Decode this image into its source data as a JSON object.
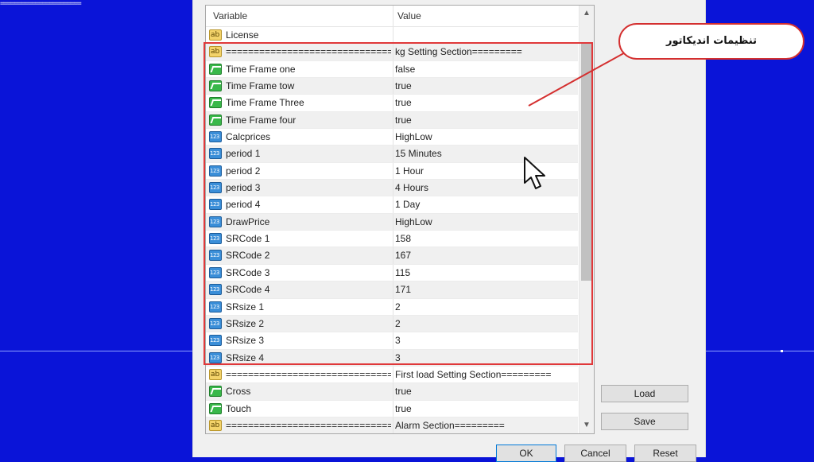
{
  "background": {
    "dashes_text": "=======================",
    "colors": {
      "desktop": "#0a14d8",
      "highlight": "#e0383a"
    }
  },
  "grid": {
    "headers": {
      "variable": "Variable",
      "value": "Value"
    },
    "rows": [
      {
        "icon": "ab-string-icon",
        "type": "ab",
        "name": "License",
        "value": ""
      },
      {
        "icon": "ab-string-icon",
        "type": "ab",
        "name": "================================",
        "value": "kg  Setting Section========="
      },
      {
        "icon": "bool-icon",
        "type": "bool",
        "name": "Time Frame one",
        "value": "false"
      },
      {
        "icon": "bool-icon",
        "type": "bool",
        "name": "Time Frame tow",
        "value": "true"
      },
      {
        "icon": "bool-icon",
        "type": "bool",
        "name": "Time Frame Three",
        "value": "true"
      },
      {
        "icon": "bool-icon",
        "type": "bool",
        "name": "Time Frame four",
        "value": "true"
      },
      {
        "icon": "number-icon",
        "type": "num",
        "name": "Calcprices",
        "value": "HighLow"
      },
      {
        "icon": "number-icon",
        "type": "num",
        "name": "period 1",
        "value": "15 Minutes"
      },
      {
        "icon": "number-icon",
        "type": "num",
        "name": "period 2",
        "value": "1 Hour"
      },
      {
        "icon": "number-icon",
        "type": "num",
        "name": "period 3",
        "value": "4 Hours"
      },
      {
        "icon": "number-icon",
        "type": "num",
        "name": "period 4",
        "value": "1 Day"
      },
      {
        "icon": "number-icon",
        "type": "num",
        "name": "DrawPrice",
        "value": "HighLow"
      },
      {
        "icon": "number-icon",
        "type": "num",
        "name": "SRCode 1",
        "value": "158"
      },
      {
        "icon": "number-icon",
        "type": "num",
        "name": "SRCode 2",
        "value": "167"
      },
      {
        "icon": "number-icon",
        "type": "num",
        "name": "SRCode 3",
        "value": "115"
      },
      {
        "icon": "number-icon",
        "type": "num",
        "name": "SRCode 4",
        "value": "171"
      },
      {
        "icon": "number-icon",
        "type": "num",
        "name": "SRsize 1",
        "value": "2"
      },
      {
        "icon": "number-icon",
        "type": "num",
        "name": "SRsize 2",
        "value": "2"
      },
      {
        "icon": "number-icon",
        "type": "num",
        "name": "SRsize 3",
        "value": "3"
      },
      {
        "icon": "number-icon",
        "type": "num",
        "name": "SRsize 4",
        "value": "3"
      },
      {
        "icon": "ab-string-icon",
        "type": "ab",
        "name": "================================",
        "value": "First load Setting Section========="
      },
      {
        "icon": "bool-icon",
        "type": "bool",
        "name": "Cross",
        "value": "true"
      },
      {
        "icon": "bool-icon",
        "type": "bool",
        "name": "Touch",
        "value": "true"
      },
      {
        "icon": "ab-string-icon",
        "type": "ab",
        "name": "================================",
        "value": "Alarm Section========="
      }
    ]
  },
  "callout": {
    "text": "تنظیمات اندیکاتور"
  },
  "buttons": {
    "load": "Load",
    "save": "Save",
    "ok": "OK",
    "cancel": "Cancel",
    "reset": "Reset"
  }
}
